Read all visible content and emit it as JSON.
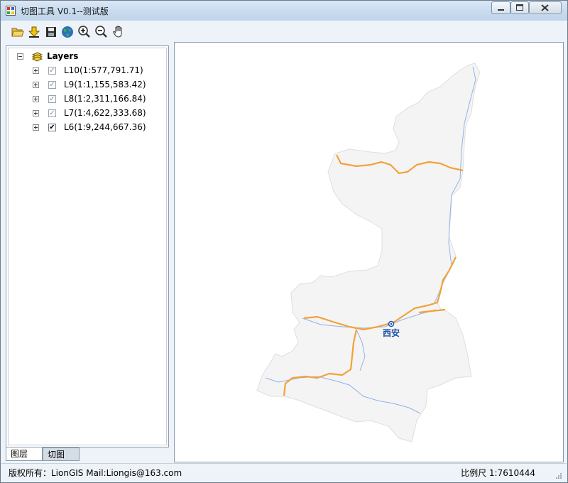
{
  "window": {
    "title": "切图工具 V0.1--测试版",
    "buttons": {
      "minimize": "minimize",
      "maximize": "maximize",
      "close": "close"
    }
  },
  "toolbar": {
    "items": [
      {
        "name": "open",
        "icon": "open-folder-icon"
      },
      {
        "name": "add",
        "icon": "add-arrow-icon"
      },
      {
        "name": "save",
        "icon": "save-disk-icon"
      },
      {
        "name": "globe",
        "icon": "globe-icon"
      },
      {
        "name": "zoom-in",
        "icon": "zoom-in-icon"
      },
      {
        "name": "zoom-out",
        "icon": "zoom-out-icon"
      },
      {
        "name": "pan",
        "icon": "pan-hand-icon"
      }
    ]
  },
  "layers": {
    "root_label": "Layers",
    "items": [
      {
        "label": "L10(1:577,791.71)",
        "checked": false
      },
      {
        "label": "L9(1:1,155,583.42)",
        "checked": false
      },
      {
        "label": "L8(1:2,311,166.84)",
        "checked": false
      },
      {
        "label": "L7(1:4,622,333.68)",
        "checked": false
      },
      {
        "label": "L6(1:9,244,667.36)",
        "checked": true
      }
    ]
  },
  "tabs": {
    "layers_tab": "图层",
    "cut_tab": "切图"
  },
  "map": {
    "city_label": "西安",
    "region_fill": "#f4f4f4",
    "road_color": "#f2a23a",
    "river_color": "#8fb3e6"
  },
  "status": {
    "copyright": "版权所有：LionGIS Mail:Liongis@163.com",
    "scale": "比例尺 1:7610444"
  }
}
